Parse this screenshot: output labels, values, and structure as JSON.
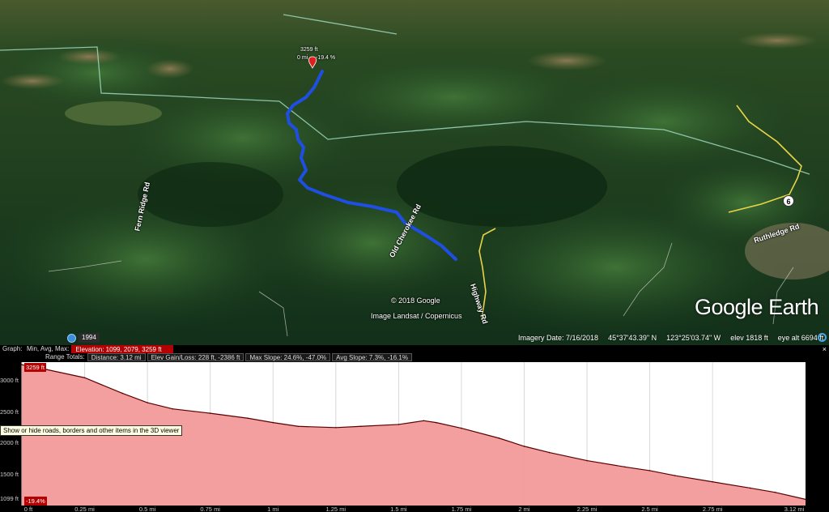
{
  "viewer": {
    "copyright": "© 2018 Google",
    "imagery_credit": "Image Landsat / Copernicus",
    "peak_elevation_label": "3259 ft",
    "peak_distance_label": "0 mi",
    "peak_slope_label": "-19.4 %",
    "road_labels": [
      "Old Cherokee Rd",
      "Fern Ridge Rd",
      "Highway Rd",
      "Ruthledge Rd"
    ],
    "route_shield": "6",
    "logo": "Google Earth",
    "year": "1994",
    "status": {
      "imagery_date": "Imagery Date: 7/16/2018",
      "latitude": "45°37'43.39\" N",
      "longitude": "123°25'03.74\" W",
      "elev": "elev  1818 ft",
      "eye_alt": "eye alt   6694 ft"
    },
    "colors": {
      "terrain_dark": "#0f2d14",
      "terrain_mid": "#1e4a22",
      "terrain_light": "#3d6b35",
      "path": "#1f4fe0",
      "road": "#e8d44a",
      "border_line": "#9fd8c0"
    },
    "icons": [
      "clock-icon",
      "compass-icon",
      "placemark-icon"
    ]
  },
  "graph_header": {
    "row1": {
      "graph_label": "Graph:",
      "stats_label": "Min, Avg, Max:",
      "elevation": "Elevation: 1099, 2079, 3259 ft"
    },
    "row2": {
      "range_label": "Range Totals:",
      "distance": "Distance: 3.12 mi",
      "gain_loss": "Elev Gain/Loss: 228 ft, -2386 ft",
      "max_slope": "Max Slope: 24.6%, -47.0%",
      "avg_slope": "Avg Slope: 7.3%, -16.1%"
    },
    "close": "×"
  },
  "graph": {
    "y_max_label": "3259 ft",
    "y_min_label": "-19.4%",
    "y_ticks": [
      "3000 ft",
      "2500 ft",
      "2000 ft",
      "1500 ft",
      "1099 ft"
    ],
    "x_ticks": [
      "0 ft",
      "0.25 mi",
      "0.5 mi",
      "0.75 mi",
      "1 mi",
      "1.25 mi",
      "1.5 mi",
      "1.75 mi",
      "2 mi",
      "2.25 mi",
      "2.5 mi",
      "2.75 mi",
      "3.12 mi"
    ],
    "tooltip": "Show or hide roads, borders and other items in the 3D viewer",
    "fill_color": "#f39a9a",
    "line_color": "#5a0000"
  },
  "chart_data": {
    "type": "area",
    "xlabel": "",
    "ylabel": "",
    "xlim": [
      0,
      3.12
    ],
    "ylim": [
      1000,
      3300
    ],
    "x": [
      0,
      0.1,
      0.25,
      0.4,
      0.5,
      0.6,
      0.75,
      0.9,
      1.0,
      1.1,
      1.25,
      1.35,
      1.5,
      1.6,
      1.65,
      1.75,
      1.9,
      2.0,
      2.1,
      2.25,
      2.4,
      2.5,
      2.6,
      2.75,
      2.9,
      3.0,
      3.12
    ],
    "series": [
      {
        "values": [
          3259,
          3180,
          3050,
          2800,
          2650,
          2550,
          2480,
          2400,
          2330,
          2270,
          2250,
          2270,
          2300,
          2360,
          2330,
          2240,
          2080,
          1950,
          1850,
          1720,
          1620,
          1560,
          1480,
          1380,
          1280,
          1210,
          1099
        ]
      }
    ]
  }
}
